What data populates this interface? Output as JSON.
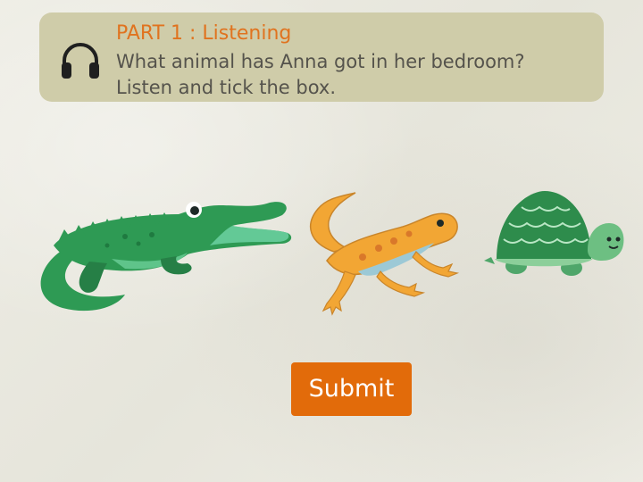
{
  "header": {
    "part_title": "PART 1 : Listening",
    "question": "What animal has Anna got in her bedroom?",
    "instruction": "Listen and tick the box.",
    "audio_icon": "headphones-icon"
  },
  "options": [
    {
      "animal": "crocodile",
      "icon": "crocodile-icon"
    },
    {
      "animal": "lizard",
      "icon": "lizard-icon"
    },
    {
      "animal": "turtle",
      "icon": "turtle-icon"
    }
  ],
  "submit_label": "Submit",
  "colors": {
    "accent": "#e26b0a",
    "title": "#e0731f",
    "panel": "#cfcca9",
    "text": "#55534c"
  }
}
